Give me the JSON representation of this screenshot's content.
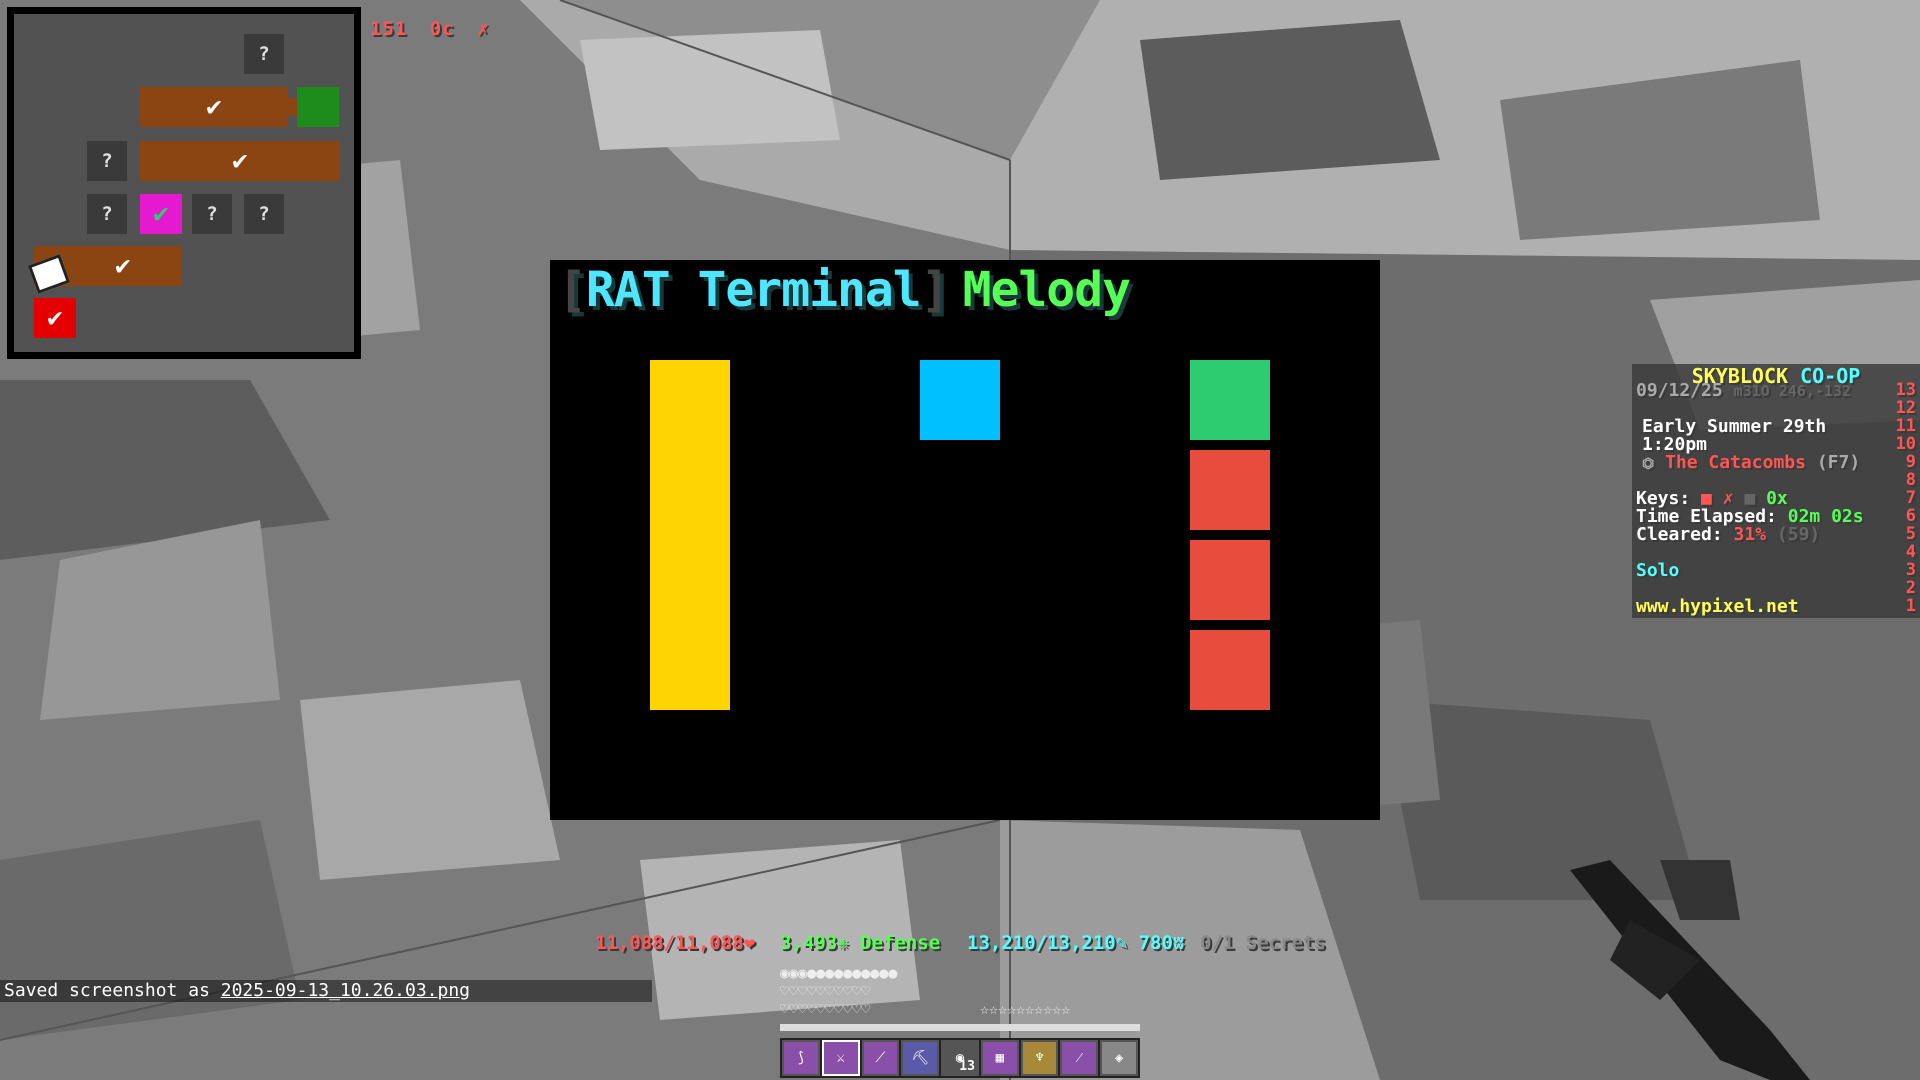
{
  "top_stat": {
    "blocks": "151",
    "count": "0c",
    "mark": "✗"
  },
  "minimap": {
    "unknown_label": "?",
    "check_glyph": "✔"
  },
  "terminal": {
    "bracket_open": "[",
    "rat": "RAT Terminal",
    "bracket_close": "]",
    "mode": "Melody",
    "colors": {
      "yellow": "#ffd400",
      "blue": "#00bfff",
      "green": "#2ecc71",
      "red": "#e74c3c"
    }
  },
  "scoreboard": {
    "title_a": "SKYBLOCK",
    "title_b": "CO-OP",
    "date": "09/12/25",
    "server": "m31O 246,-132",
    "season": "Early Summer 29th",
    "time": "1:20pm",
    "location_icon": "⏣",
    "location": "The Catacombs",
    "floor": "(F7)",
    "keys_label": "Keys:",
    "keys_wither": "■",
    "keys_wither_val": "✗",
    "keys_blood": "■",
    "keys_blood_val": "0x",
    "elapsed_label": "Time Elapsed:",
    "elapsed_val": "02m 02s",
    "cleared_label": "Cleared:",
    "cleared_val": "31%",
    "cleared_extra": "(59)",
    "mode": "Solo",
    "website": "www.hypixel.net",
    "numbers": [
      "13",
      "12",
      "11",
      "10",
      "9",
      "8",
      "7",
      "6",
      "5",
      "4",
      "3",
      "2",
      "1"
    ]
  },
  "actionbar": {
    "health": "11,088/11,088❤",
    "defense": "3,493❈ Defense",
    "mana": "13,210/13,210✎ 780ʬ",
    "secrets": "0/1 Secrets"
  },
  "chat": {
    "prefix": "Saved screenshot as ",
    "file": "2025-09-13_10.26.03.png"
  },
  "status_rows": {
    "armor": "◉◉◉●●●●●●●●●●",
    "hearts1": "♡♡♡♡♡♡♡♡♡♡",
    "hearts2": "♡♡♡♡♡♡♡♡♡♡",
    "hunger": "☆☆☆☆☆☆☆☆☆☆"
  },
  "hotbar": [
    {
      "icon": "bow-icon",
      "glyph": "⟆"
    },
    {
      "icon": "sword-icon",
      "glyph": "⚔"
    },
    {
      "icon": "wand-icon",
      "glyph": "⟋"
    },
    {
      "icon": "pickaxe-icon",
      "glyph": "⛏"
    },
    {
      "icon": "pearl-icon",
      "glyph": "◉",
      "count": "13"
    },
    {
      "icon": "chest-icon",
      "glyph": "▦"
    },
    {
      "icon": "trident-icon",
      "glyph": "♆"
    },
    {
      "icon": "rod-icon",
      "glyph": "⁄"
    },
    {
      "icon": "map-icon",
      "glyph": "◈"
    }
  ]
}
